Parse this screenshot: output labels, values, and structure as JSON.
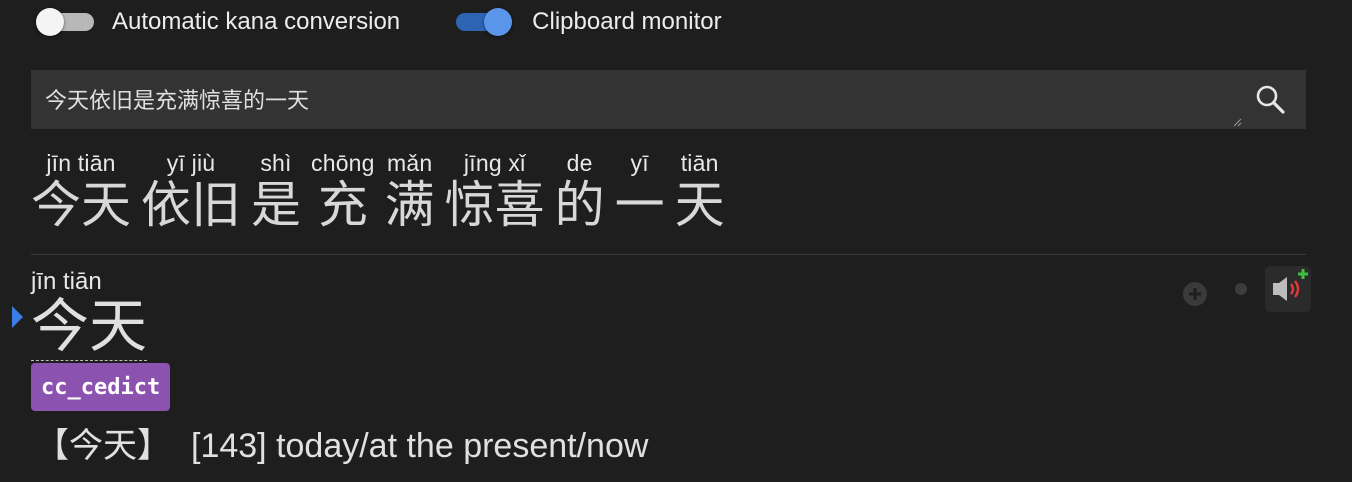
{
  "toggles": {
    "kana": {
      "label": "Automatic kana conversion",
      "state": "off"
    },
    "clipboard": {
      "label": "Clipboard monitor",
      "state": "on"
    }
  },
  "search": {
    "value": "今天依旧是充满惊喜的一天"
  },
  "sentence": [
    {
      "pinyin": "jīn  tiān",
      "hanzi": "今天"
    },
    {
      "pinyin": "yī   jiù",
      "hanzi": "依旧"
    },
    {
      "pinyin": "shì",
      "hanzi": "是"
    },
    {
      "pinyin": "chōng",
      "hanzi": "充"
    },
    {
      "pinyin": "mǎn",
      "hanzi": "满"
    },
    {
      "pinyin": "jīng  xǐ",
      "hanzi": "惊喜"
    },
    {
      "pinyin": "de",
      "hanzi": "的"
    },
    {
      "pinyin": "yī",
      "hanzi": "一"
    },
    {
      "pinyin": "tiān",
      "hanzi": "天"
    }
  ],
  "entry": {
    "pinyin": "jīn  tiān",
    "hanzi": "今天",
    "dictionary": "cc_cedict",
    "headword": "【今天】",
    "definition": "[143] today/at the present/now"
  },
  "colors": {
    "background": "#1e1e1e",
    "toggle_on": "#5b95ea",
    "badge": "#8c52b0",
    "audio_red": "#e03a3a",
    "audio_plus": "#3fbf3f"
  }
}
